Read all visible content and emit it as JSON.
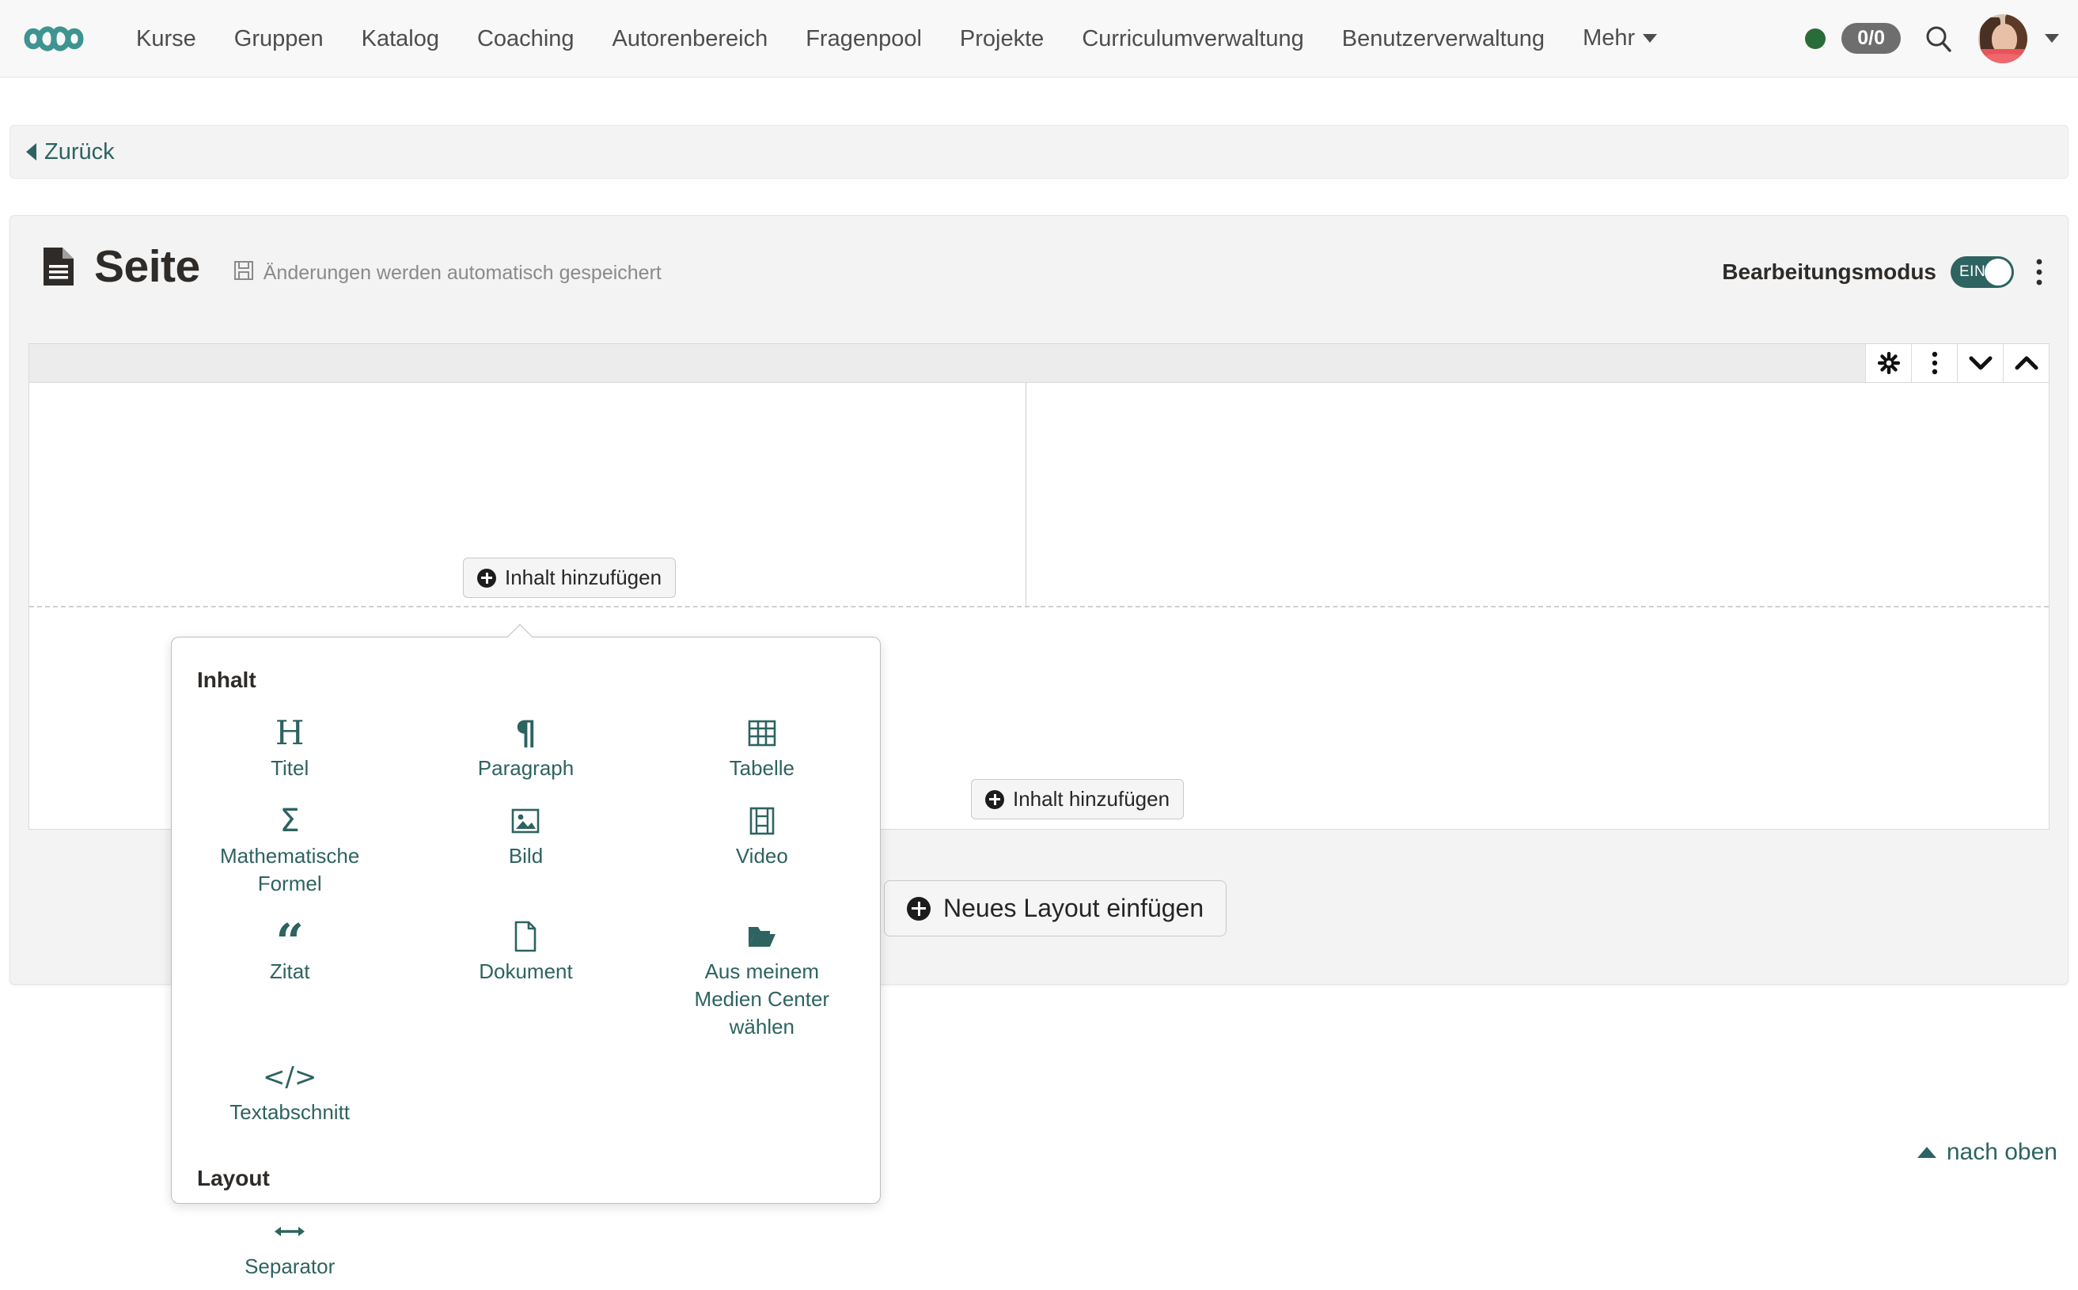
{
  "topnav": {
    "brand_icon": "infinity-logo",
    "items": [
      {
        "label": "Kurse"
      },
      {
        "label": "Gruppen"
      },
      {
        "label": "Katalog"
      },
      {
        "label": "Coaching"
      },
      {
        "label": "Autorenbereich"
      },
      {
        "label": "Fragenpool"
      },
      {
        "label": "Projekte"
      },
      {
        "label": "Curriculumverwaltung"
      },
      {
        "label": "Benutzerverwaltung"
      },
      {
        "label": "Mehr"
      }
    ],
    "status_dot_color": "#2a6b3a",
    "count_badge": "0/0",
    "count_badge_color": "#6e6e6e",
    "search_icon": "search-icon",
    "avatar_caret": "caret-down-icon"
  },
  "backbar": {
    "label": "Zurück",
    "icon": "chevron-left-icon",
    "accent": "#2d6360"
  },
  "page": {
    "icon": "document-icon",
    "title": "Seite",
    "autosave_icon": "floppy-disk-icon",
    "autosave_text": "Änderungen werden automatisch gespeichert",
    "edit_mode_label": "Bearbeitungsmodus",
    "toggle_state": "EIN",
    "toggle_color": "#2d6360",
    "kebab_icon": "kebab-menu-icon"
  },
  "editor": {
    "toolbar_buttons": [
      {
        "icon": "gear-icon",
        "name": "settings"
      },
      {
        "icon": "kebab-menu-icon",
        "name": "more-options"
      },
      {
        "icon": "chevron-down-icon",
        "name": "move-down"
      },
      {
        "icon": "chevron-up-icon",
        "name": "move-up"
      }
    ],
    "add_content_label": "Inhalt hinzufügen",
    "new_layout_label": "Neues Layout einfügen"
  },
  "popup": {
    "section_content_title": "Inhalt",
    "content_items": [
      {
        "label": "Titel",
        "icon": "heading-icon"
      },
      {
        "label": "Paragraph",
        "icon": "pilcrow-icon"
      },
      {
        "label": "Tabelle",
        "icon": "table-icon"
      },
      {
        "label": "Mathematische Formel",
        "icon": "sigma-icon"
      },
      {
        "label": "Bild",
        "icon": "image-icon"
      },
      {
        "label": "Video",
        "icon": "film-icon"
      },
      {
        "label": "Zitat",
        "icon": "quote-icon"
      },
      {
        "label": "Dokument",
        "icon": "file-icon"
      },
      {
        "label": "Aus meinem Medien Center wählen",
        "icon": "open-folder-icon"
      },
      {
        "label": "Textabschnitt",
        "icon": "code-icon"
      }
    ],
    "section_layout_title": "Layout",
    "layout_items": [
      {
        "label": "Separator",
        "icon": "arrows-horizontal-icon"
      }
    ]
  },
  "footer": {
    "back_to_top": "nach oben",
    "back_to_top_icon": "chevron-up-icon"
  }
}
